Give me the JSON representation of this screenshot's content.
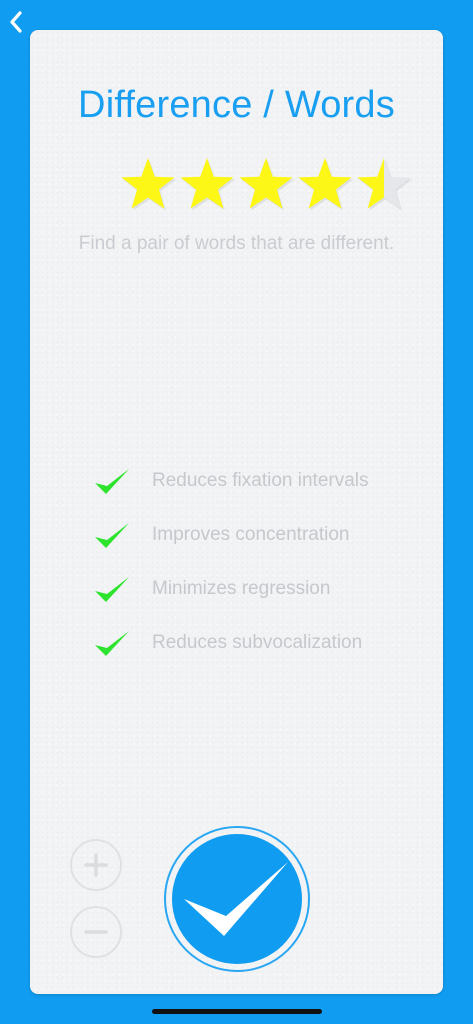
{
  "header": {
    "back_icon": "chevron-left-icon"
  },
  "exercise": {
    "title": "Difference / Words",
    "rating": {
      "value": 4.5,
      "max": 5
    },
    "description": "Find a pair of words that are different.",
    "benefits": [
      {
        "icon": "green-check-icon",
        "label": "Reduces fixation intervals"
      },
      {
        "icon": "green-check-icon",
        "label": "Improves concentration"
      },
      {
        "icon": "green-check-icon",
        "label": "Minimizes regression"
      },
      {
        "icon": "green-check-icon",
        "label": "Reduces subvocalization"
      }
    ]
  },
  "controls": {
    "zoom_in_icon": "plus-icon",
    "zoom_out_icon": "minus-icon",
    "confirm_icon": "checkmark-icon"
  },
  "colors": {
    "background": "#109cf0",
    "title": "#199ff2",
    "star": "#fcf716",
    "check": "#2ee32e"
  }
}
